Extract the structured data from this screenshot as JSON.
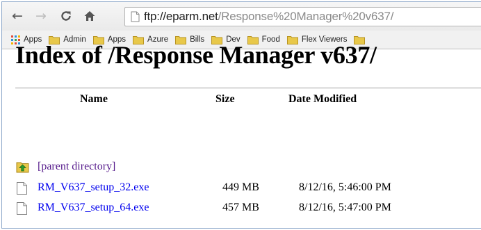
{
  "browser": {
    "url_host": "ftp://eparm.net",
    "url_path": "/Response%20Manager%20v637/"
  },
  "bookmarks": [
    {
      "label": "Apps",
      "icon": "apps-grid-icon"
    },
    {
      "label": "Admin",
      "icon": "folder-icon"
    },
    {
      "label": "Apps",
      "icon": "folder-icon"
    },
    {
      "label": "Azure",
      "icon": "folder-icon"
    },
    {
      "label": "Bills",
      "icon": "folder-icon"
    },
    {
      "label": "Dev",
      "icon": "folder-icon"
    },
    {
      "label": "Food",
      "icon": "folder-icon"
    },
    {
      "label": "Flex Viewers",
      "icon": "folder-icon"
    }
  ],
  "page": {
    "title": "Index of /Response Manager v637/",
    "columns": {
      "name": "Name",
      "size": "Size",
      "date": "Date Modified"
    },
    "parent_link": "[parent directory]",
    "files": [
      {
        "name": "RM_V637_setup_32.exe",
        "size": "449 MB",
        "date": "8/12/16, 5:46:00 PM"
      },
      {
        "name": "RM_V637_setup_64.exe",
        "size": "457 MB",
        "date": "8/12/16, 5:47:00 PM"
      }
    ]
  },
  "colors": {
    "link": "#0000ee",
    "visited_link": "#551a8b",
    "folder": "#e8c84a"
  }
}
